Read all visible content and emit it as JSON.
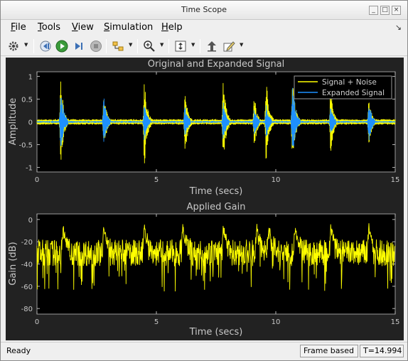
{
  "window": {
    "title": "Time Scope"
  },
  "menu": [
    {
      "label": "File",
      "accel": "F"
    },
    {
      "label": "Tools",
      "accel": "T"
    },
    {
      "label": "View",
      "accel": "V"
    },
    {
      "label": "Simulation",
      "accel": "S"
    },
    {
      "label": "Help",
      "accel": "H"
    }
  ],
  "toolbar": {
    "icons": [
      "settings-icon",
      "step-back-icon",
      "run-icon",
      "step-forward-icon",
      "stop-icon",
      "simulink-highlight-icon",
      "zoom-in-icon",
      "scale-axes-icon",
      "restore-view-icon",
      "edit-icon"
    ]
  },
  "colors": {
    "background": "#222222",
    "axes": "#000000",
    "signal_noise": "#ffff00",
    "expanded": "#1e90ff",
    "gain": "#ffff00",
    "text": "#c8c8c8"
  },
  "chart_data": [
    {
      "type": "line",
      "title": "Original and Expanded Signal",
      "xlabel": "Time (secs)",
      "ylabel": "Amplitude",
      "xlim": [
        0,
        15
      ],
      "ylim": [
        -1.1,
        1.1
      ],
      "xticks": [
        0,
        5,
        10,
        15
      ],
      "yticks": [
        1,
        0.5,
        0,
        -0.5,
        -1
      ],
      "grid": false,
      "legend_position": "top-right",
      "series": [
        {
          "name": "Signal + Noise",
          "color": "#ffff00"
        },
        {
          "name": "Expanded Signal",
          "color": "#1e90ff"
        }
      ],
      "bursts": [
        {
          "t": 1.0,
          "amp_noise": 1.0,
          "amp_expanded": 0.78
        },
        {
          "t": 2.8,
          "amp_noise": 0.65,
          "amp_expanded": 0.6
        },
        {
          "t": 4.5,
          "amp_noise": 1.0,
          "amp_expanded": 0.45
        },
        {
          "t": 6.2,
          "amp_noise": 0.75,
          "amp_expanded": 0.4
        },
        {
          "t": 7.8,
          "amp_noise": 1.0,
          "amp_expanded": 0.48
        },
        {
          "t": 9.1,
          "amp_noise": 0.6,
          "amp_expanded": 0.35
        },
        {
          "t": 9.6,
          "amp_noise": 1.0,
          "amp_expanded": 0.4
        },
        {
          "t": 10.7,
          "amp_noise": 1.0,
          "amp_expanded": 0.95
        },
        {
          "t": 12.3,
          "amp_noise": 0.75,
          "amp_expanded": 0.38
        },
        {
          "t": 13.9,
          "amp_noise": 0.55,
          "amp_expanded": 0.5
        }
      ],
      "noise_floor": 0.06
    },
    {
      "type": "line",
      "title": "Applied Gain",
      "xlabel": "Time (secs)",
      "ylabel": "Gain (dB)",
      "xlim": [
        0,
        15
      ],
      "ylim": [
        -85,
        5
      ],
      "xticks": [
        0,
        5,
        10,
        15
      ],
      "yticks": [
        0,
        -20,
        -40,
        -60,
        -80
      ],
      "grid": false,
      "series": [
        {
          "color": "#ffff00"
        }
      ],
      "baseline_db": -30,
      "spread_db": 12,
      "dips_db": -65,
      "peaks": [
        1.1,
        2.8,
        4.5,
        6.1,
        7.8,
        9.2,
        9.7,
        10.8,
        12.3,
        13.9
      ],
      "peak_db": -2
    }
  ],
  "status": {
    "ready": "Ready",
    "mode": "Frame based",
    "time": "T=14.994"
  }
}
